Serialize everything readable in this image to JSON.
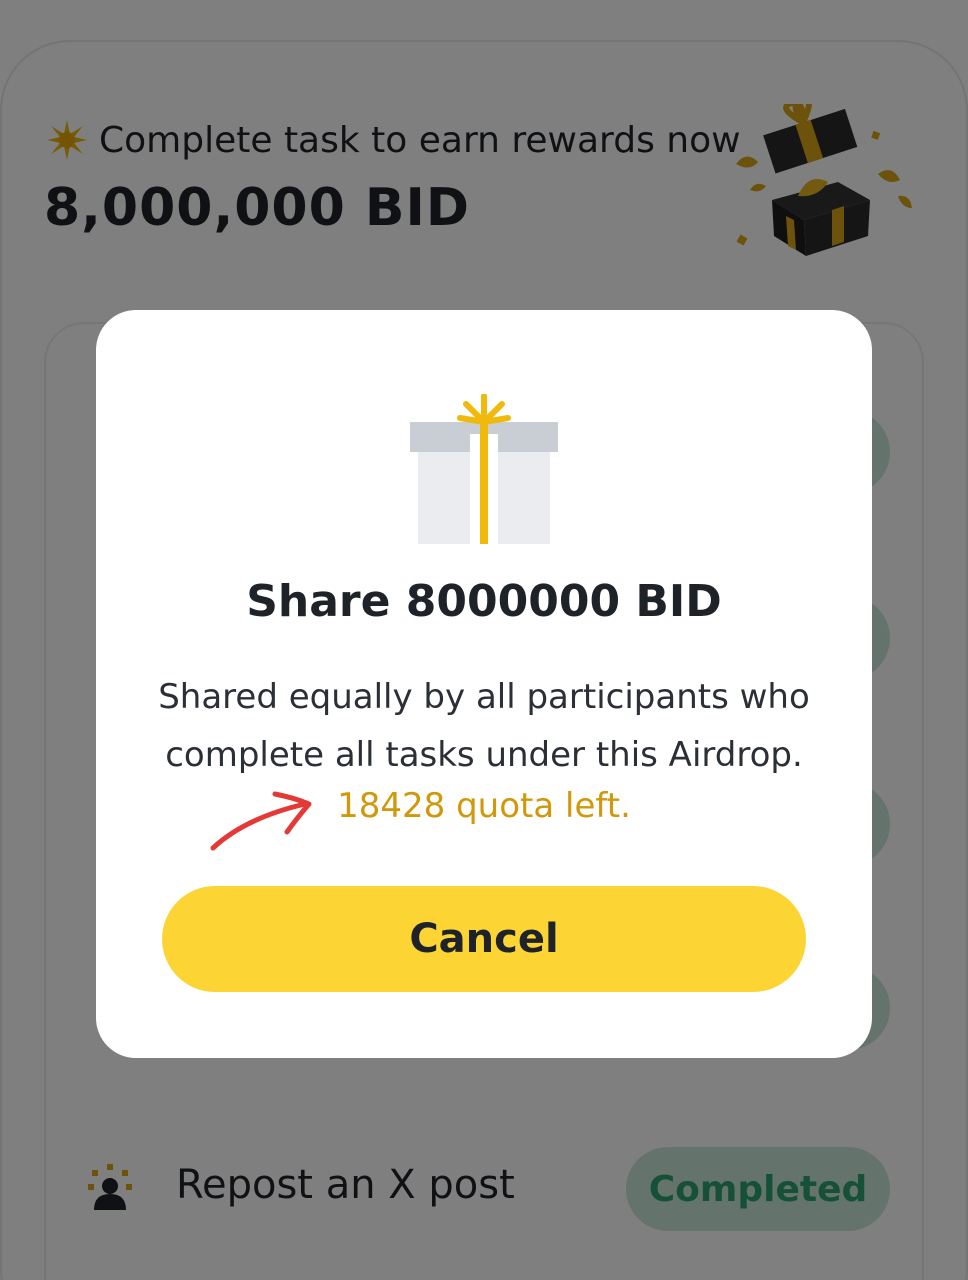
{
  "header": {
    "tagline": "Complete task to earn rewards now",
    "reward_amount": "8,000,000 BID",
    "tagline_icon": "sparkle-icon",
    "illustration_icon": "gift-box-illustration"
  },
  "tasks": {
    "last_task_label": "Repost an X post",
    "last_task_status": "Completed",
    "task_icon": "user-group-icon"
  },
  "modal": {
    "icon": "gift-icon",
    "title": "Share 8000000 BID",
    "description_line1": "Shared equally by all participants who",
    "description_line2": "complete all tasks under this Airdrop.",
    "quota_text": "18428 quota left.",
    "cancel_label": "Cancel",
    "annotation": "hand-drawn-red-arrow"
  },
  "colors": {
    "accent_yellow": "#FCD535",
    "quota_gold": "#D0980B",
    "completed_green": "#2EA173",
    "completed_bg": "#C9E8D8",
    "annotation_red": "#E53935",
    "text_dark": "#1E2329"
  }
}
